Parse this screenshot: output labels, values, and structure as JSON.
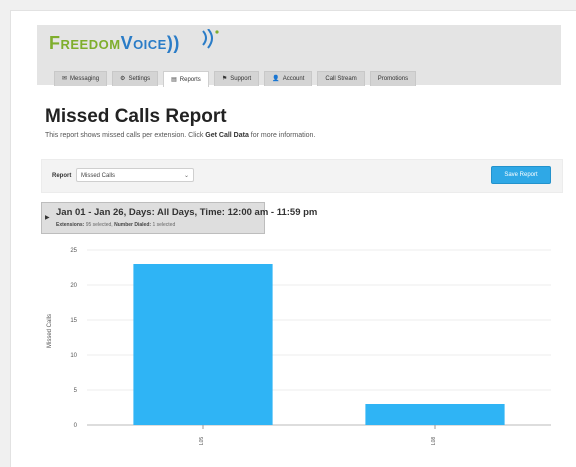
{
  "brand": {
    "part1": "Freedom",
    "part2": "Voice))",
    "accent": "#2a7cc7",
    "green": "#7fae2d"
  },
  "tabs": [
    {
      "label": "Messaging",
      "icon": "envelope-icon",
      "active": false
    },
    {
      "label": "Settings",
      "icon": "gear-icon",
      "active": false
    },
    {
      "label": "Reports",
      "icon": "report-icon",
      "active": true
    },
    {
      "label": "Support",
      "icon": "flag-icon",
      "active": false
    },
    {
      "label": "Account",
      "icon": "user-icon",
      "active": false
    },
    {
      "label": "Call Stream",
      "icon": "",
      "active": false
    },
    {
      "label": "Promotions",
      "icon": "",
      "active": false
    }
  ],
  "page": {
    "title": "Missed Calls Report",
    "desc_prefix": "This report shows missed calls per extension. Click ",
    "desc_bold": "Get Call Data",
    "desc_suffix": " for more information."
  },
  "filter": {
    "label": "Report",
    "selected": "Missed Calls",
    "save_label": "Save Report"
  },
  "summary": {
    "line1": "Jan 01 - Jan 26, Days: All Days, Time: 12:00 am - 11:59 pm",
    "ext_label": "Extensions:",
    "ext_value": "95 selected,",
    "num_label": "Number Dialed:",
    "num_value": "1 selected"
  },
  "chart_data": {
    "type": "bar",
    "categories": [
      "L05",
      "L08"
    ],
    "values": [
      23,
      3
    ],
    "ylabel": "Missed Calls",
    "ylim": [
      0,
      25
    ],
    "yticks": [
      0,
      5,
      10,
      15,
      20,
      25
    ],
    "grid": true,
    "bar_color": "#2fb4f5"
  }
}
